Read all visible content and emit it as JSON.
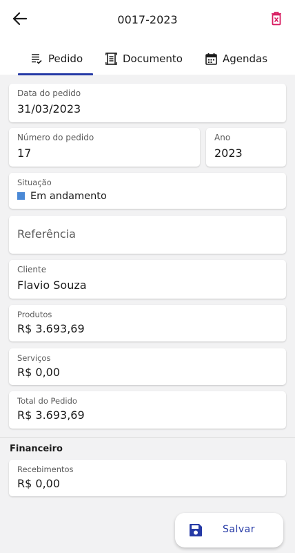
{
  "header": {
    "title": "0017-2023",
    "back_icon": "arrow-left-icon",
    "delete_icon": "trash-icon",
    "delete_color": "#d81b60"
  },
  "tabs": [
    {
      "label": "Pedido",
      "icon": "list-icon",
      "active": true
    },
    {
      "label": "Documento",
      "icon": "document-icon",
      "active": false
    },
    {
      "label": "Agendas",
      "icon": "calendar-icon",
      "active": false
    }
  ],
  "accent_color": "#263aa6",
  "form": {
    "data_pedido": {
      "label": "Data do pedido",
      "value": "31/03/2023"
    },
    "numero_pedido": {
      "label": "Número do pedido",
      "value": "17"
    },
    "ano": {
      "label": "Ano",
      "value": "2023"
    },
    "situacao": {
      "label": "Situação",
      "value": "Em andamento",
      "status_color": "#4a89d6"
    },
    "referencia": {
      "placeholder": "Referência"
    },
    "cliente": {
      "label": "Cliente",
      "value": "Flavio Souza"
    },
    "produtos": {
      "label": "Produtos",
      "value": "R$ 3.693,69"
    },
    "servicos": {
      "label": "Serviços",
      "value": "R$ 0,00"
    },
    "total": {
      "label": "Total do Pedido",
      "value": "R$ 3.693,69"
    }
  },
  "financeiro": {
    "title": "Financeiro",
    "recebimentos": {
      "label": "Recebimentos",
      "value": "R$ 0,00"
    }
  },
  "save_button": {
    "label": "Salvar",
    "icon": "floppy-disk-icon"
  }
}
